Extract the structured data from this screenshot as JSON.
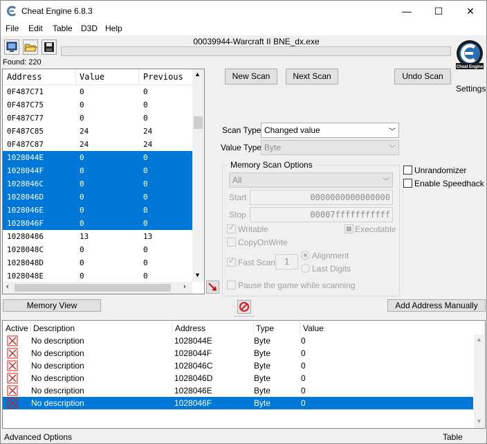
{
  "window": {
    "title": "Cheat Engine 6.8.3",
    "minimize": "—",
    "maximize": "☐",
    "close": "✕"
  },
  "menu": [
    "File",
    "Edit",
    "Table",
    "D3D",
    "Help"
  ],
  "process_name": "00039944-Warcraft II BNE_dx.exe",
  "found_label": "Found: 220",
  "scan_buttons": {
    "new_scan": "New Scan",
    "next_scan": "Next Scan",
    "undo_scan": "Undo Scan"
  },
  "settings_label": "Settings",
  "logo_text": "Cheat Engine",
  "results": {
    "columns": [
      "Address",
      "Value",
      "Previous"
    ],
    "rows": [
      {
        "address": "0F487C71",
        "value": "0",
        "previous": "0",
        "selected": false
      },
      {
        "address": "0F487C75",
        "value": "0",
        "previous": "0",
        "selected": false
      },
      {
        "address": "0F487C77",
        "value": "0",
        "previous": "0",
        "selected": false
      },
      {
        "address": "0F487C85",
        "value": "24",
        "previous": "24",
        "selected": false
      },
      {
        "address": "0F487C87",
        "value": "24",
        "previous": "24",
        "selected": false
      },
      {
        "address": "1028044E",
        "value": "0",
        "previous": "0",
        "selected": true
      },
      {
        "address": "1028044F",
        "value": "0",
        "previous": "0",
        "selected": true
      },
      {
        "address": "1028046C",
        "value": "0",
        "previous": "0",
        "selected": true
      },
      {
        "address": "1028046D",
        "value": "0",
        "previous": "0",
        "selected": true
      },
      {
        "address": "1028046E",
        "value": "0",
        "previous": "0",
        "selected": true
      },
      {
        "address": "1028046F",
        "value": "0",
        "previous": "0",
        "selected": true
      },
      {
        "address": "10280486",
        "value": "13",
        "previous": "13",
        "selected": false
      },
      {
        "address": "1028048C",
        "value": "0",
        "previous": "0",
        "selected": false
      },
      {
        "address": "1028048D",
        "value": "0",
        "previous": "0",
        "selected": false
      },
      {
        "address": "1028048E",
        "value": "0",
        "previous": "0",
        "selected": false
      }
    ]
  },
  "scan_options": {
    "scan_type_label": "Scan Type",
    "scan_type_value": "Changed value",
    "value_type_label": "Value Type",
    "value_type_value": "Byte",
    "memory_scan_options_label": "Memory Scan Options",
    "region_value": "All",
    "start_label": "Start",
    "start_value": "0000000000000000",
    "stop_label": "Stop",
    "stop_value": "00007fffffffffff",
    "writable_label": "Writable",
    "executable_label": "Executable",
    "copyonwrite_label": "CopyOnWrite",
    "fast_scan_label": "Fast Scan",
    "fast_scan_value": "1",
    "alignment_label": "Alignment",
    "last_digits_label": "Last Digits",
    "pause_label": "Pause the game while scanning",
    "unrandomizer_label": "Unrandomizer",
    "speedhack_label": "Enable Speedhack"
  },
  "memory_view_label": "Memory View",
  "add_address_label": "Add Address Manually",
  "address_table": {
    "columns": [
      "Active",
      "Description",
      "Address",
      "Type",
      "Value"
    ],
    "rows": [
      {
        "description": "No description",
        "address": "1028044E",
        "type": "Byte",
        "value": "0",
        "selected": false
      },
      {
        "description": "No description",
        "address": "1028044F",
        "type": "Byte",
        "value": "0",
        "selected": false
      },
      {
        "description": "No description",
        "address": "1028046C",
        "type": "Byte",
        "value": "0",
        "selected": false
      },
      {
        "description": "No description",
        "address": "1028046D",
        "type": "Byte",
        "value": "0",
        "selected": false
      },
      {
        "description": "No description",
        "address": "1028046E",
        "type": "Byte",
        "value": "0",
        "selected": false
      },
      {
        "description": "No description",
        "address": "1028046F",
        "type": "Byte",
        "value": "0",
        "selected": true
      }
    ]
  },
  "status": {
    "left": "Advanced Options",
    "right": "Table Extras"
  },
  "colors": {
    "selection": "#0078d7",
    "window_bg": "#f0f0f0",
    "deactivate_red": "#cc1c1c",
    "arrow_red": "#c81010"
  }
}
